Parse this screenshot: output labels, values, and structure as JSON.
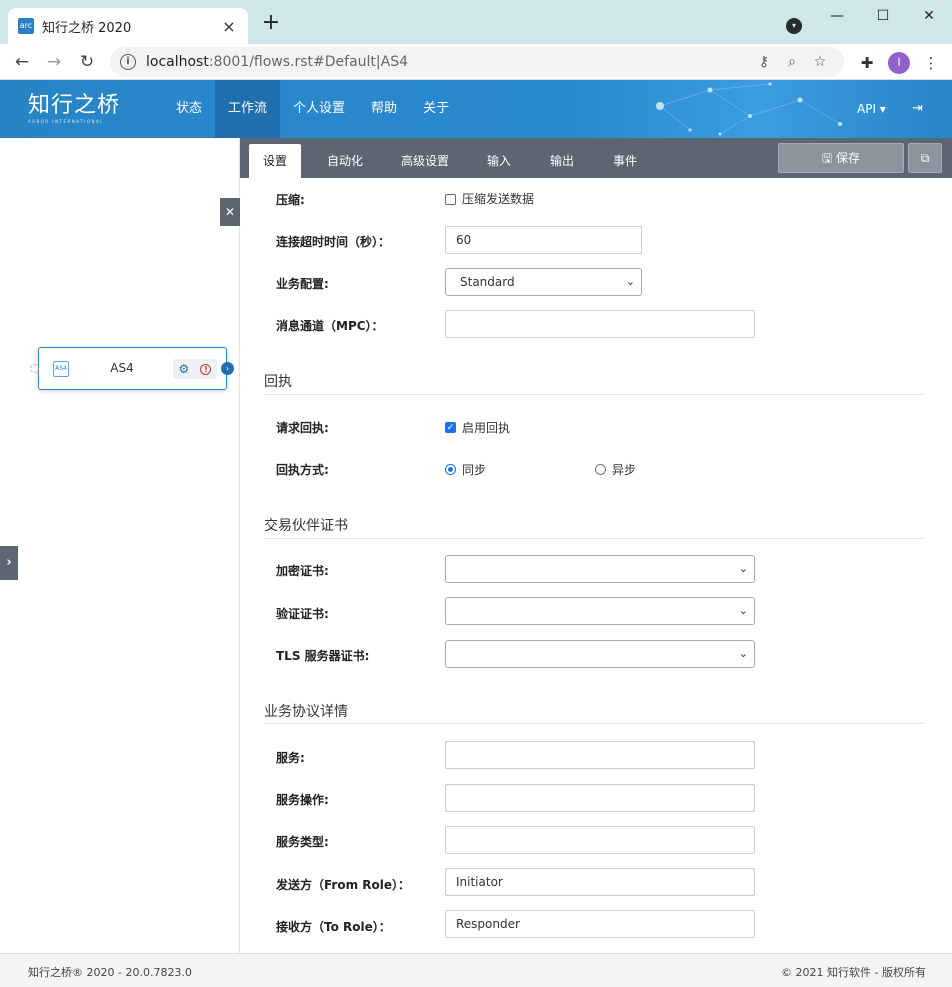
{
  "browser": {
    "tab_title": "知行之桥 2020",
    "favicon_text": "arc",
    "url_host": "localhost",
    "url_rest": ":8001/flows.rst#Default|AS4",
    "avatar_letter": "I"
  },
  "header": {
    "logo_main": "知行之桥",
    "logo_sub": "ARBOR INTERNATIONAL",
    "nav": [
      "状态",
      "工作流",
      "个人设置",
      "帮助",
      "关于"
    ],
    "active_nav": "工作流",
    "api_label": "API ▾",
    "colors": {
      "header_bg": "#2785c6",
      "active_nav_bg": "#1f6fae"
    }
  },
  "canvas": {
    "node_label": "AS4",
    "node_icon_text": "AS4"
  },
  "panel": {
    "tabs": [
      "设置",
      "自动化",
      "高级设置",
      "输入",
      "输出",
      "事件"
    ],
    "active_tab": "设置",
    "save_label": "保存"
  },
  "form": {
    "compression": {
      "label": "压缩:",
      "checkbox_label": "压缩发送数据",
      "checked": false
    },
    "timeout": {
      "label": "连接超时时间（秒）：",
      "value": "60"
    },
    "profile": {
      "label": "业务配置:",
      "value": "Standard"
    },
    "mpc": {
      "label": "消息通道（MPC）：",
      "value": ""
    },
    "receipt_section": "回执",
    "request_receipt": {
      "label": "请求回执:",
      "checkbox_label": "启用回执",
      "checked": true
    },
    "receipt_mode": {
      "label": "回执方式:",
      "options": [
        "同步",
        "异步"
      ],
      "selected": "同步"
    },
    "cert_section": "交易伙伴证书",
    "encryption_cert": {
      "label": "加密证书:",
      "value": ""
    },
    "verify_cert": {
      "label": "验证证书:",
      "value": ""
    },
    "tls_cert": {
      "label": "TLS 服务器证书:",
      "value": ""
    },
    "agreement_section": "业务协议详情",
    "service": {
      "label": "服务:",
      "value": ""
    },
    "service_action": {
      "label": "服务操作:",
      "value": ""
    },
    "service_type": {
      "label": "服务类型:",
      "value": ""
    },
    "from_role": {
      "label": "发送方（From Role）：",
      "value": "Initiator"
    },
    "to_role": {
      "label": "接收方（To Role）：",
      "value": "Responder"
    }
  },
  "footer": {
    "left": "知行之桥® 2020 - 20.0.7823.0",
    "right": "© 2021 知行软件 - 版权所有"
  }
}
